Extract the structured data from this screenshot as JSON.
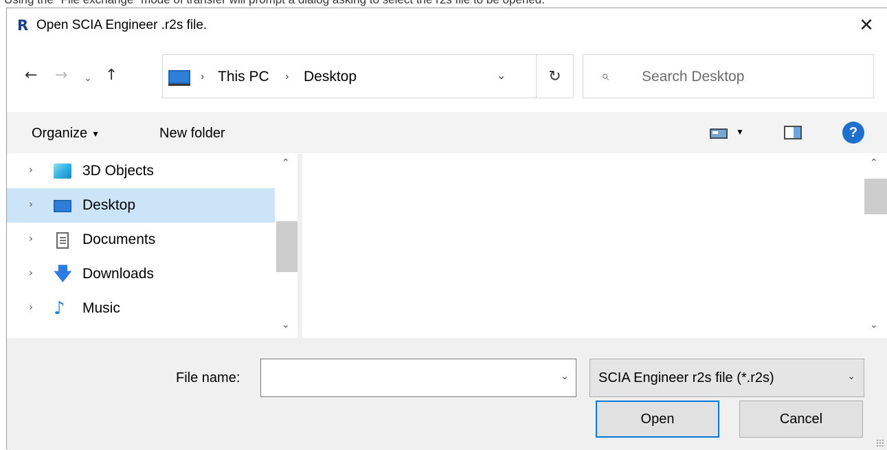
{
  "caption": "Using the \"File exchange\" mode of transfer will prompt a dialog asking to select the r2s file to be opened.",
  "dialog": {
    "app_icon_letter": "R",
    "title": "Open SCIA Engineer .r2s file.",
    "close_glyph": "✕"
  },
  "nav": {
    "back_glyph": "←",
    "forward_glyph": "→",
    "recent_glyph": "⌄",
    "up_glyph": "↑",
    "breadcrumb": [
      "This PC",
      "Desktop"
    ],
    "breadcrumb_sep": "›",
    "address_dropdown_glyph": "⌄",
    "refresh_glyph": "↻",
    "search_placeholder": "Search Desktop"
  },
  "toolbar": {
    "organize_label": "Organize",
    "new_folder_label": "New folder",
    "help_label": "?"
  },
  "tree": {
    "items": [
      {
        "label": "3D Objects",
        "icon": "3d-objects-icon",
        "selected": false
      },
      {
        "label": "Desktop",
        "icon": "desktop-icon",
        "selected": true
      },
      {
        "label": "Documents",
        "icon": "documents-icon",
        "selected": false
      },
      {
        "label": "Downloads",
        "icon": "downloads-icon",
        "selected": false
      },
      {
        "label": "Music",
        "icon": "music-icon",
        "selected": false
      }
    ],
    "chevron_glyph": "›",
    "down_arrow_glyph": "🡇",
    "music_glyph": "♪"
  },
  "bottom": {
    "file_name_label": "File name:",
    "file_name_value": "",
    "file_type_selected": "SCIA Engineer r2s file (*.r2s)",
    "open_label": "Open",
    "cancel_label": "Cancel"
  },
  "colors": {
    "accent": "#0078d7",
    "selection": "#cce4f7",
    "toolbar_bg": "#f3f3f3",
    "bottom_bg": "#f0f0f0"
  }
}
